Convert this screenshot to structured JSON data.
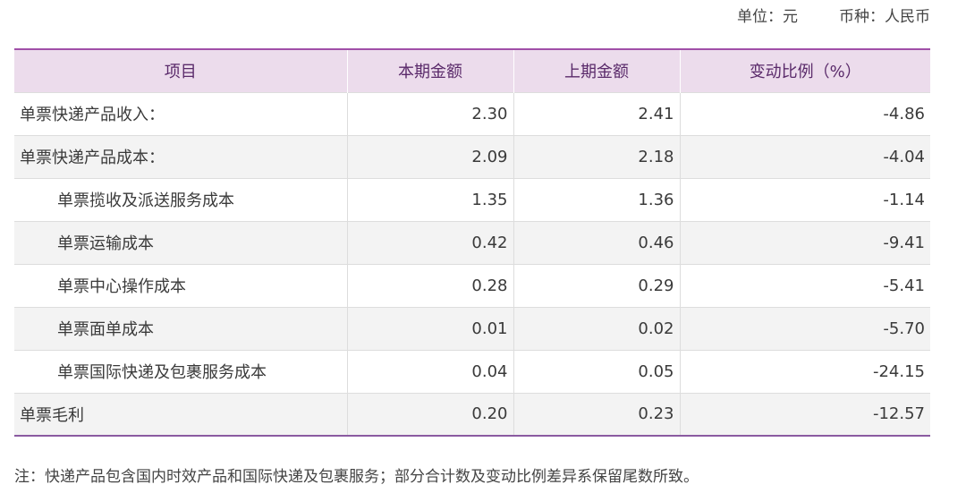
{
  "header": {
    "unit_label": "单位：元",
    "currency_label": "币种：人民币"
  },
  "table": {
    "columns": [
      "项目",
      "本期金额",
      "上期金额",
      "变动比例（%）"
    ],
    "rows": [
      {
        "item": "单票快递产品收入：",
        "current": "2.30",
        "previous": "2.41",
        "change": "-4.86",
        "indent": false
      },
      {
        "item": "单票快递产品成本：",
        "current": "2.09",
        "previous": "2.18",
        "change": "-4.04",
        "indent": false
      },
      {
        "item": "单票揽收及派送服务成本",
        "current": "1.35",
        "previous": "1.36",
        "change": "-1.14",
        "indent": true
      },
      {
        "item": "单票运输成本",
        "current": "0.42",
        "previous": "0.46",
        "change": "-9.41",
        "indent": true
      },
      {
        "item": "单票中心操作成本",
        "current": "0.28",
        "previous": "0.29",
        "change": "-5.41",
        "indent": true
      },
      {
        "item": "单票面单成本",
        "current": "0.01",
        "previous": "0.02",
        "change": "-5.70",
        "indent": true
      },
      {
        "item": "单票国际快递及包裹服务成本",
        "current": "0.04",
        "previous": "0.05",
        "change": "-24.15",
        "indent": true
      },
      {
        "item": "单票毛利",
        "current": "0.20",
        "previous": "0.23",
        "change": "-12.57",
        "indent": false
      }
    ]
  },
  "note": "注：快递产品包含国内时效产品和国际快递及包裹服务；部分合计数及变动比例差异系保留尾数所致。"
}
